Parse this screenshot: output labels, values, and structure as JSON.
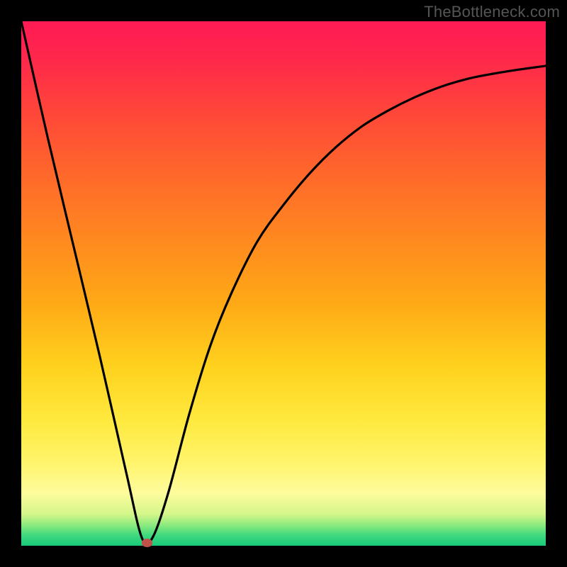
{
  "attribution": "TheBottleneck.com",
  "colors": {
    "background": "#000000",
    "plot_gradient_top": "#ff1a55",
    "plot_gradient_bottom": "#18c97a",
    "curve_stroke": "#000000",
    "marker_fill": "#c0524a",
    "attribution_text": "#555555"
  },
  "chart_data": {
    "type": "line",
    "title": "",
    "xlabel": "",
    "ylabel": "",
    "xlim": [
      0,
      100
    ],
    "ylim": [
      0,
      100
    ],
    "series": [
      {
        "name": "bottleneck-curve",
        "x": [
          0,
          5,
          10,
          15,
          20,
          23,
          25,
          28,
          32,
          36,
          40,
          45,
          50,
          55,
          60,
          65,
          70,
          75,
          80,
          85,
          90,
          95,
          100
        ],
        "y": [
          100,
          78,
          57,
          36,
          14,
          1.5,
          1.5,
          10,
          25,
          38,
          48,
          58,
          65,
          71,
          76,
          80,
          83,
          85.5,
          87.5,
          89,
          90,
          90.8,
          91.5
        ]
      }
    ],
    "annotations": [
      {
        "name": "minimum-marker",
        "x": 24,
        "y": 0.5
      }
    ],
    "legend": false,
    "grid": false
  }
}
